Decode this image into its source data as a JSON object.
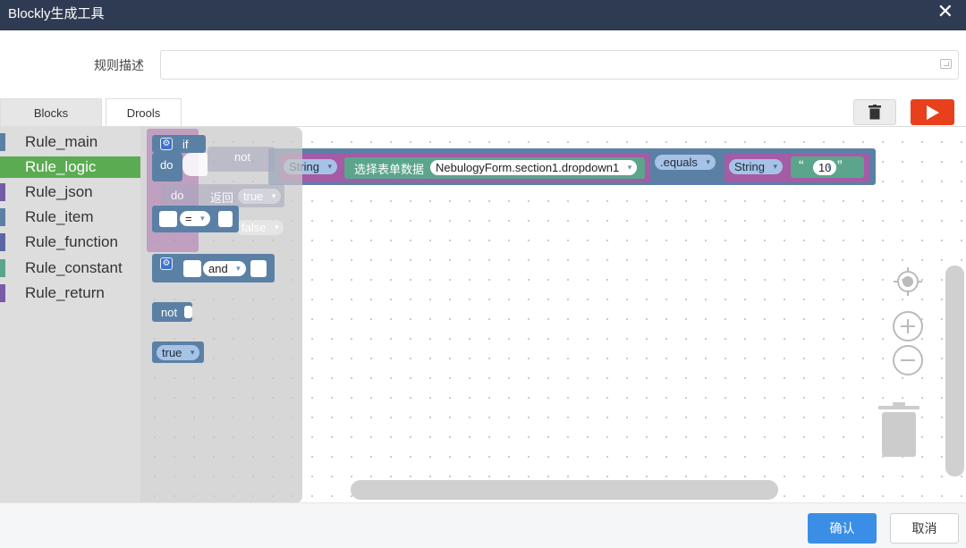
{
  "window": {
    "title": "Blockly生成工具",
    "close_icon": "close-icon"
  },
  "rule_description": {
    "label": "规则描述",
    "value": "",
    "placeholder": ""
  },
  "tabs": [
    {
      "label": "Blocks",
      "active": true
    },
    {
      "label": "Drools",
      "active": false
    }
  ],
  "toolbar": {
    "trash_icon": "trash-icon",
    "run_icon": "play-icon",
    "run_color": "#e8401c"
  },
  "toolbox": {
    "items": [
      {
        "label": "Rule_main",
        "color": "#5b80a5"
      },
      {
        "label": "Rule_logic",
        "color": "#5ba55b",
        "selected": true
      },
      {
        "label": "Rule_json",
        "color": "#745ba5"
      },
      {
        "label": "Rule_item",
        "color": "#5b80a5"
      },
      {
        "label": "Rule_function",
        "color": "#5b67a5"
      },
      {
        "label": "Rule_constant",
        "color": "#5ba58c"
      },
      {
        "label": "Rule_return",
        "color": "#7a5ba5"
      }
    ]
  },
  "flyout": {
    "if_block": {
      "if_label": "if",
      "do_label": "do"
    },
    "compare_block": {
      "operator": "="
    },
    "logic_block": {
      "operator": "and"
    },
    "negate_block": {
      "label": "not"
    },
    "boolean_block": {
      "value": "true"
    }
  },
  "ghost_blocks": {
    "not_label": "not",
    "do_label": "do",
    "return_label": "返回",
    "true_value": "true",
    "false_value": "false"
  },
  "canvas": {
    "type_dropdown_1": "String",
    "form_label": "选择表单数据",
    "form_field": "NebulogyForm.section1.dropdown1",
    "method": ".equals",
    "type_dropdown_2": "String",
    "quote_open": "“",
    "string_value": "10",
    "quote_close": "”"
  },
  "footer": {
    "confirm_label": "确认",
    "cancel_label": "取消",
    "confirm_color": "#3a8ee6"
  }
}
